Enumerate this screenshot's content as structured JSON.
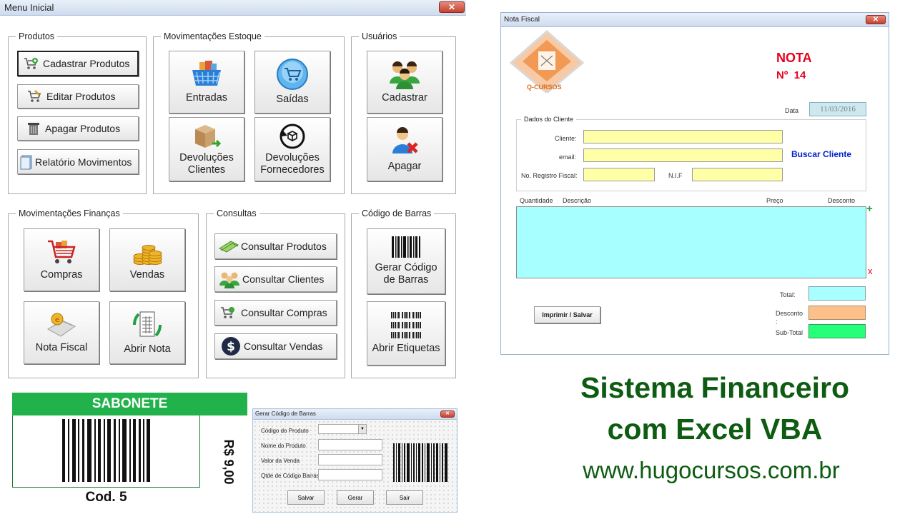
{
  "menu": {
    "title": "Menu Inicial",
    "close": "✕",
    "groups": {
      "produtos": {
        "legend": "Produtos",
        "cadastrar": "Cadastrar Produtos",
        "editar": "Editar Produtos",
        "apagar": "Apagar Produtos",
        "relatorio": "Relatório Movimentos"
      },
      "estoque": {
        "legend": "Movimentações Estoque",
        "entradas": "Entradas",
        "saidas": "Saídas",
        "dev_clientes": "Devoluções\nClientes",
        "dev_fornecedores": "Devoluções\nFornecedores"
      },
      "usuarios": {
        "legend": "Usuários",
        "cadastrar": "Cadastrar",
        "apagar": "Apagar"
      },
      "financas": {
        "legend": "Movimentações Finanças",
        "compras": "Compras",
        "vendas": "Vendas",
        "nota_fiscal": "Nota Fiscal",
        "abrir_nota": "Abrir Nota"
      },
      "consultas": {
        "legend": "Consultas",
        "produtos": "Consultar Produtos",
        "clientes": "Consultar Clientes",
        "compras": "Consultar Compras",
        "vendas": "Consultar Vendas"
      },
      "barras": {
        "legend": "Código de Barras",
        "gerar": "Gerar Código\nde Barras",
        "etiquetas": "Abrir Etiquetas"
      }
    }
  },
  "nota": {
    "title": "Nota Fiscal",
    "close": "✕",
    "logo_text": "Q-CURSOS",
    "heading": "NOTA",
    "numero": "Nº  14",
    "data_label": "Data",
    "data_value": "11/03/2016",
    "cliente_legend": "Dados do Cliente",
    "cliente_label": "Cliente:",
    "email_label": "email:",
    "registro_label": "No. Registro Fiscal:",
    "nif_label": "N.I.F",
    "buscar": "Buscar Cliente",
    "col_quantidade": "Quantidade",
    "col_descricao": "Descrição",
    "col_preco": "Preço",
    "col_desconto": "Desconto",
    "add": "+",
    "remove": "x",
    "total_label": "Total:",
    "desconto_label": "Desconto\n:",
    "subtotal_label": "Sub-Total",
    "imprimir": "Imprimir / Salvar",
    "colors": {
      "input_yellow": "#ffffa8",
      "grid_cyan": "#a8ffff",
      "desconto": "#fcc18b",
      "subtotal": "#26ff7a",
      "red_text": "#e8001c",
      "blue_link": "#0022cc"
    }
  },
  "label": {
    "product": "SABONETE",
    "price": "R$ 9,00",
    "code": "Cod. 5",
    "band_color": "#21b24b"
  },
  "gerador": {
    "title": "Gerar Código de Barras",
    "close": "✕",
    "codigo_label": "Código do Produto",
    "nome_label": "Nome do Produto",
    "valor_label": "Valor da Venda",
    "qtde_label": "Qtde de Código Barras",
    "salvar": "Salvar",
    "gerar": "Gerar",
    "sair": "Sair"
  },
  "promo": {
    "line1": "Sistema Financeiro",
    "line2": "com Excel VBA",
    "url": "www.hugocursos.com.br",
    "color": "#0e5b12"
  }
}
